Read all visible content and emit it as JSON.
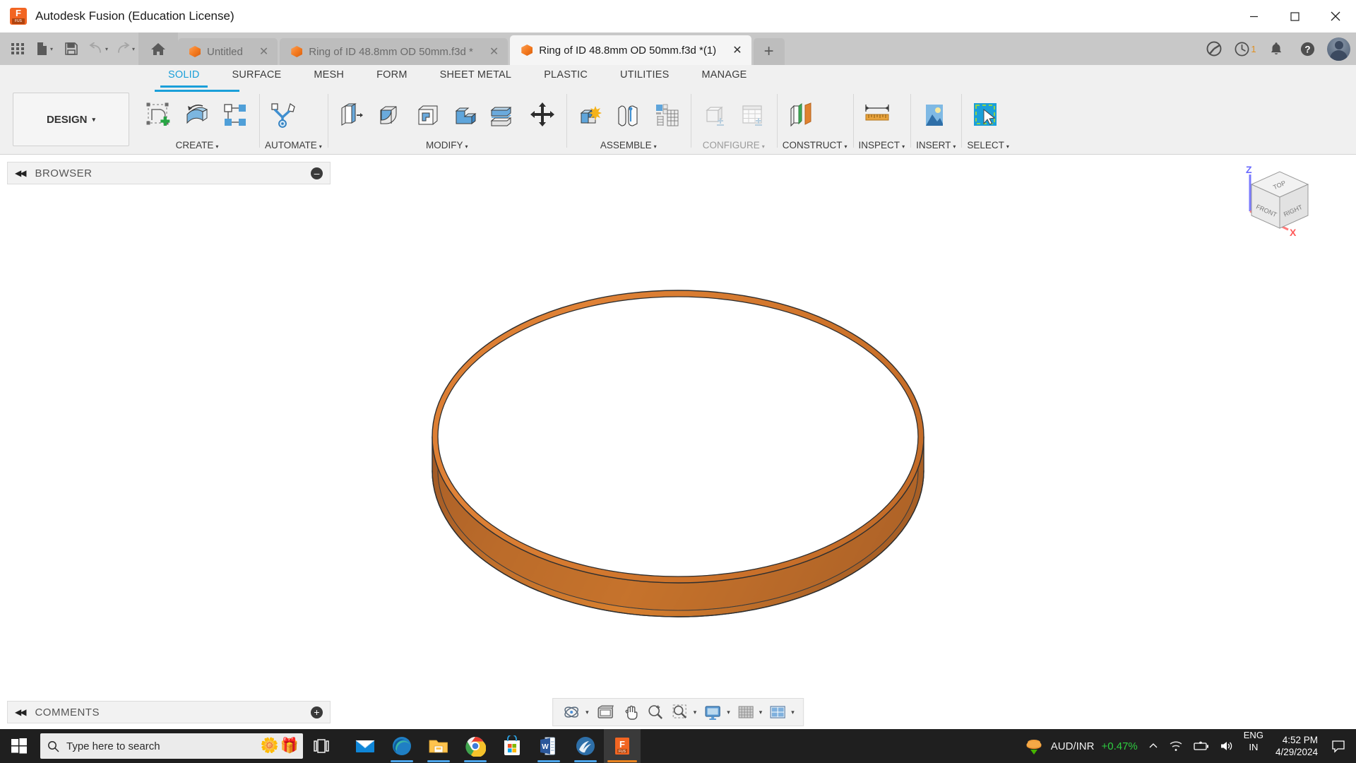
{
  "window": {
    "app_title": "Autodesk Fusion (Education License)",
    "logo_letter": "F",
    "logo_tag": "FUS",
    "minimize": "–",
    "maximize": "□",
    "close": "✕"
  },
  "quick_access": {
    "grid_label": "app-grid",
    "new_label": "new-file",
    "save_label": "save",
    "undo_label": "undo",
    "redo_label": "redo",
    "home_label": "home",
    "caret": "▾"
  },
  "file_tabs": [
    {
      "title": "Untitled",
      "active": false,
      "close": "✕"
    },
    {
      "title": "Ring of ID 48.8mm  OD 50mm.f3d *",
      "active": false,
      "close": "✕"
    },
    {
      "title": "Ring of ID 48.8mm  OD 50mm.f3d *(1)",
      "active": true,
      "close": "✕"
    }
  ],
  "tab_add_label": "+",
  "tabbar_right": {
    "extension_icon": "extension-icon",
    "history_count": "1",
    "notification_icon": "bell-icon",
    "help_icon": "help-icon",
    "avatar_icon": "user-avatar"
  },
  "ribbon": {
    "workspace": "DESIGN",
    "workspace_caret": "▾",
    "tabs": [
      {
        "label": "SOLID",
        "active": true
      },
      {
        "label": "SURFACE",
        "active": false
      },
      {
        "label": "MESH",
        "active": false
      },
      {
        "label": "FORM",
        "active": false
      },
      {
        "label": "SHEET METAL",
        "active": false
      },
      {
        "label": "PLASTIC",
        "active": false
      },
      {
        "label": "UTILITIES",
        "active": false
      },
      {
        "label": "MANAGE",
        "active": false
      }
    ],
    "panels": [
      {
        "label": "CREATE",
        "caret": "▾",
        "disabled": false,
        "icon_count": 3
      },
      {
        "label": "AUTOMATE",
        "caret": "▾",
        "disabled": false,
        "icon_count": 1
      },
      {
        "label": "MODIFY",
        "caret": "▾",
        "disabled": false,
        "icon_count": 6
      },
      {
        "label": "ASSEMBLE",
        "caret": "▾",
        "disabled": false,
        "icon_count": 3
      },
      {
        "label": "CONFIGURE",
        "caret": "▾",
        "disabled": true,
        "icon_count": 2
      },
      {
        "label": "CONSTRUCT",
        "caret": "▾",
        "disabled": false,
        "icon_count": 1
      },
      {
        "label": "INSPECT",
        "caret": "▾",
        "disabled": false,
        "icon_count": 1
      },
      {
        "label": "INSERT",
        "caret": "▾",
        "disabled": false,
        "icon_count": 1
      },
      {
        "label": "SELECT",
        "caret": "▾",
        "disabled": false,
        "icon_count": 1
      }
    ]
  },
  "browser": {
    "title": "BROWSER",
    "collapse_arrows": "◀◀",
    "toggle": "–"
  },
  "comments": {
    "title": "COMMENTS",
    "collapse_arrows": "◀◀",
    "toggle": "+"
  },
  "viewcube": {
    "top": "TOP",
    "front": "FRONT",
    "right": "RIGHT",
    "axis_z": "Z",
    "axis_x": "X"
  },
  "model": {
    "name": "ring-solid-body",
    "face_top_color": "#d9782c",
    "face_outer_color": "#b5632a",
    "face_inner_color": "#c9732f",
    "edge_color": "#3a3a3a"
  },
  "navbar": {
    "items": [
      {
        "name": "orbit-icon",
        "caret": "▾"
      },
      {
        "name": "look-at-icon",
        "caret": ""
      },
      {
        "name": "pan-icon",
        "caret": ""
      },
      {
        "name": "zoom-icon",
        "caret": ""
      },
      {
        "name": "zoom-window-icon",
        "caret": "▾"
      },
      {
        "name": "display-settings-icon",
        "caret": "▾"
      },
      {
        "name": "grid-snaps-icon",
        "caret": "▾"
      },
      {
        "name": "viewports-icon",
        "caret": "▾"
      }
    ]
  },
  "taskbar": {
    "search_placeholder": "Type here to search",
    "search_value": "",
    "apps": [
      {
        "name": "mail-icon",
        "active": false,
        "running": false
      },
      {
        "name": "edge-icon",
        "active": false,
        "running": true
      },
      {
        "name": "file-explorer-icon",
        "active": false,
        "running": true
      },
      {
        "name": "chrome-icon",
        "active": false,
        "running": true
      },
      {
        "name": "microsoft-store-icon",
        "active": false,
        "running": false
      },
      {
        "name": "word-icon",
        "active": false,
        "running": true
      },
      {
        "name": "rhino-icon",
        "active": false,
        "running": true
      },
      {
        "name": "fusion-icon",
        "active": true,
        "running": true
      }
    ],
    "tray": {
      "stock_label": "AUD/INR",
      "stock_change": "+0.47%",
      "stock_color": "#2ecc40",
      "overflow_caret": "⌃",
      "network_icon": "wifi-icon",
      "battery_icon": "battery-charging-icon",
      "volume_icon": "volume-icon",
      "lang_line1": "ENG",
      "lang_line2": "IN",
      "time": "4:52 PM",
      "date": "4/29/2024",
      "notification_icon": "action-center-icon"
    }
  }
}
